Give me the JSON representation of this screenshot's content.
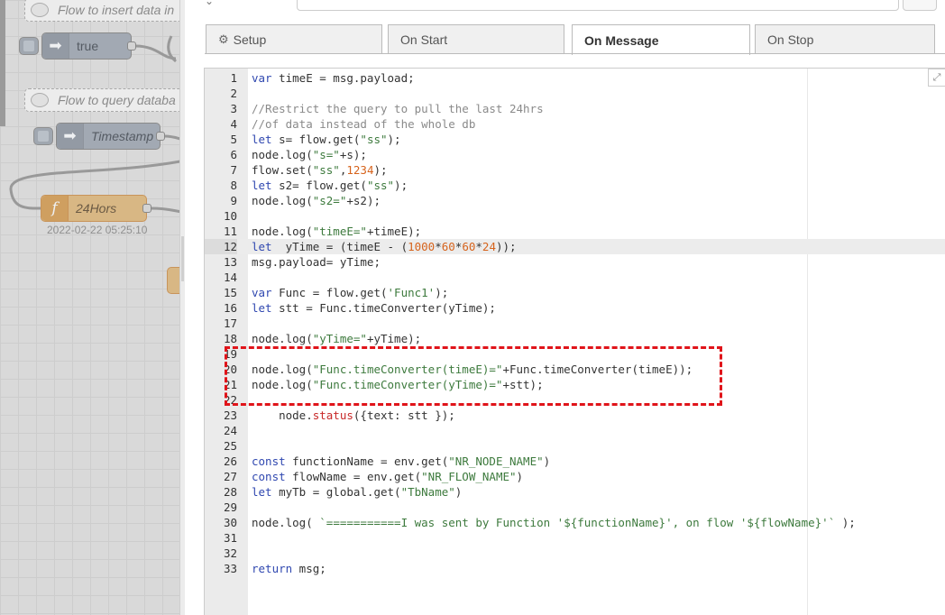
{
  "workspace": {
    "comment1": "Flow to insert data in",
    "inject1": "true",
    "comment2": "Flow to query databa",
    "inject2": "Timestamp",
    "function_node": "24Hors",
    "function_status": "2022-02-22 05:25:10"
  },
  "tabs": [
    {
      "label": "Setup"
    },
    {
      "label": "On Start"
    },
    {
      "label": "On Message"
    },
    {
      "label": "On Stop"
    }
  ],
  "editor": {
    "active_line": 12,
    "expand_icon": "⤢",
    "lines": [
      {
        "n": "1",
        "t": "var timeE = msg.payload;"
      },
      {
        "n": "2",
        "t": ""
      },
      {
        "n": "3",
        "t": "//Restrict the query to pull the last 24hrs"
      },
      {
        "n": "4",
        "t": "//of data instead of the whole db"
      },
      {
        "n": "5",
        "t": "let s= flow.get(\"ss\");"
      },
      {
        "n": "6",
        "t": "node.log(\"s=\"+s);"
      },
      {
        "n": "7",
        "t": "flow.set(\"ss\",1234);"
      },
      {
        "n": "8",
        "t": "let s2= flow.get(\"ss\");"
      },
      {
        "n": "9",
        "t": "node.log(\"s2=\"+s2);"
      },
      {
        "n": "10",
        "t": ""
      },
      {
        "n": "11",
        "t": "node.log(\"timeE=\"+timeE);"
      },
      {
        "n": "12",
        "t": "let  yTime = (timeE - (1000*60*60*24));"
      },
      {
        "n": "13",
        "t": "msg.payload= yTime;"
      },
      {
        "n": "14",
        "t": ""
      },
      {
        "n": "15",
        "t": "var Func = flow.get('Func1');"
      },
      {
        "n": "16",
        "t": "let stt = Func.timeConverter(yTime);"
      },
      {
        "n": "17",
        "t": ""
      },
      {
        "n": "18",
        "t": "node.log(\"yTime=\"+yTime);"
      },
      {
        "n": "19",
        "t": ""
      },
      {
        "n": "20",
        "t": "node.log(\"Func.timeConverter(timeE)=\"+Func.timeConverter(timeE));"
      },
      {
        "n": "21",
        "t": "node.log(\"Func.timeConverter(yTime)=\"+stt);"
      },
      {
        "n": "22",
        "t": ""
      },
      {
        "n": "23",
        "t": "    node.status({text: stt });"
      },
      {
        "n": "24",
        "t": ""
      },
      {
        "n": "25",
        "t": ""
      },
      {
        "n": "26",
        "t": "const functionName = env.get(\"NR_NODE_NAME\")"
      },
      {
        "n": "27",
        "t": "const flowName = env.get(\"NR_FLOW_NAME\")"
      },
      {
        "n": "28",
        "t": "let myTb = global.get(\"TbName\")"
      },
      {
        "n": "29",
        "t": ""
      },
      {
        "n": "30",
        "t": "node.log( `===========I was sent by Function '${functionName}', on flow '${flowName}'` );"
      },
      {
        "n": "31",
        "t": ""
      },
      {
        "n": "32",
        "t": ""
      },
      {
        "n": "33",
        "t": "return msg;"
      }
    ]
  }
}
